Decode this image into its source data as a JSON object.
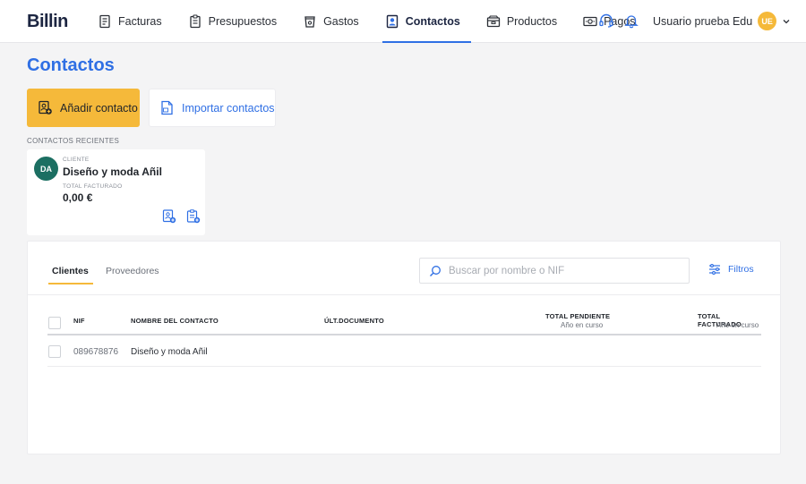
{
  "app": {
    "logo": "Billin"
  },
  "nav": [
    {
      "label": "Facturas",
      "icon": "invoice-icon"
    },
    {
      "label": "Presupuestos",
      "icon": "clipboard-icon"
    },
    {
      "label": "Gastos",
      "icon": "cup-icon"
    },
    {
      "label": "Contactos",
      "icon": "contact-icon",
      "active": true
    },
    {
      "label": "Productos",
      "icon": "box-icon"
    },
    {
      "label": "Pagos",
      "icon": "banknote-icon"
    }
  ],
  "user": {
    "name": "Usuario prueba Edu",
    "initials": "UE"
  },
  "page": {
    "title": "Contactos"
  },
  "actions": {
    "add_label": "Añadir contacto",
    "import_label": "Importar contactos"
  },
  "recent": {
    "label": "CONTACTOS RECIENTES",
    "card": {
      "initials": "DA",
      "type": "CLIENTE",
      "name": "Diseño y moda Añil",
      "total_label": "TOTAL FACTURADO",
      "total_value": "0,00 €"
    }
  },
  "tabs": {
    "clients": "Clientes",
    "providers": "Proveedores"
  },
  "search": {
    "placeholder": "Buscar por nombre o NIF",
    "value": ""
  },
  "filters": {
    "label": "Filtros"
  },
  "table": {
    "columns": {
      "nif": "NIF",
      "name": "NOMBRE DEL CONTACTO",
      "last_doc": "ÚLT.DOCUMENTO",
      "pending": "TOTAL PENDIENTE",
      "pending_sub": "Año en curso",
      "billed": "TOTAL FACTURADO",
      "billed_sub": "Año en curso"
    },
    "rows": [
      {
        "nif": "089678876",
        "name": "Diseño y moda Añil",
        "last_doc": "",
        "pending": "",
        "billed": ""
      }
    ]
  },
  "colors": {
    "accent": "#2f6fe4",
    "primary_button": "#f5b93a",
    "avatar_card": "#1c6f62"
  }
}
